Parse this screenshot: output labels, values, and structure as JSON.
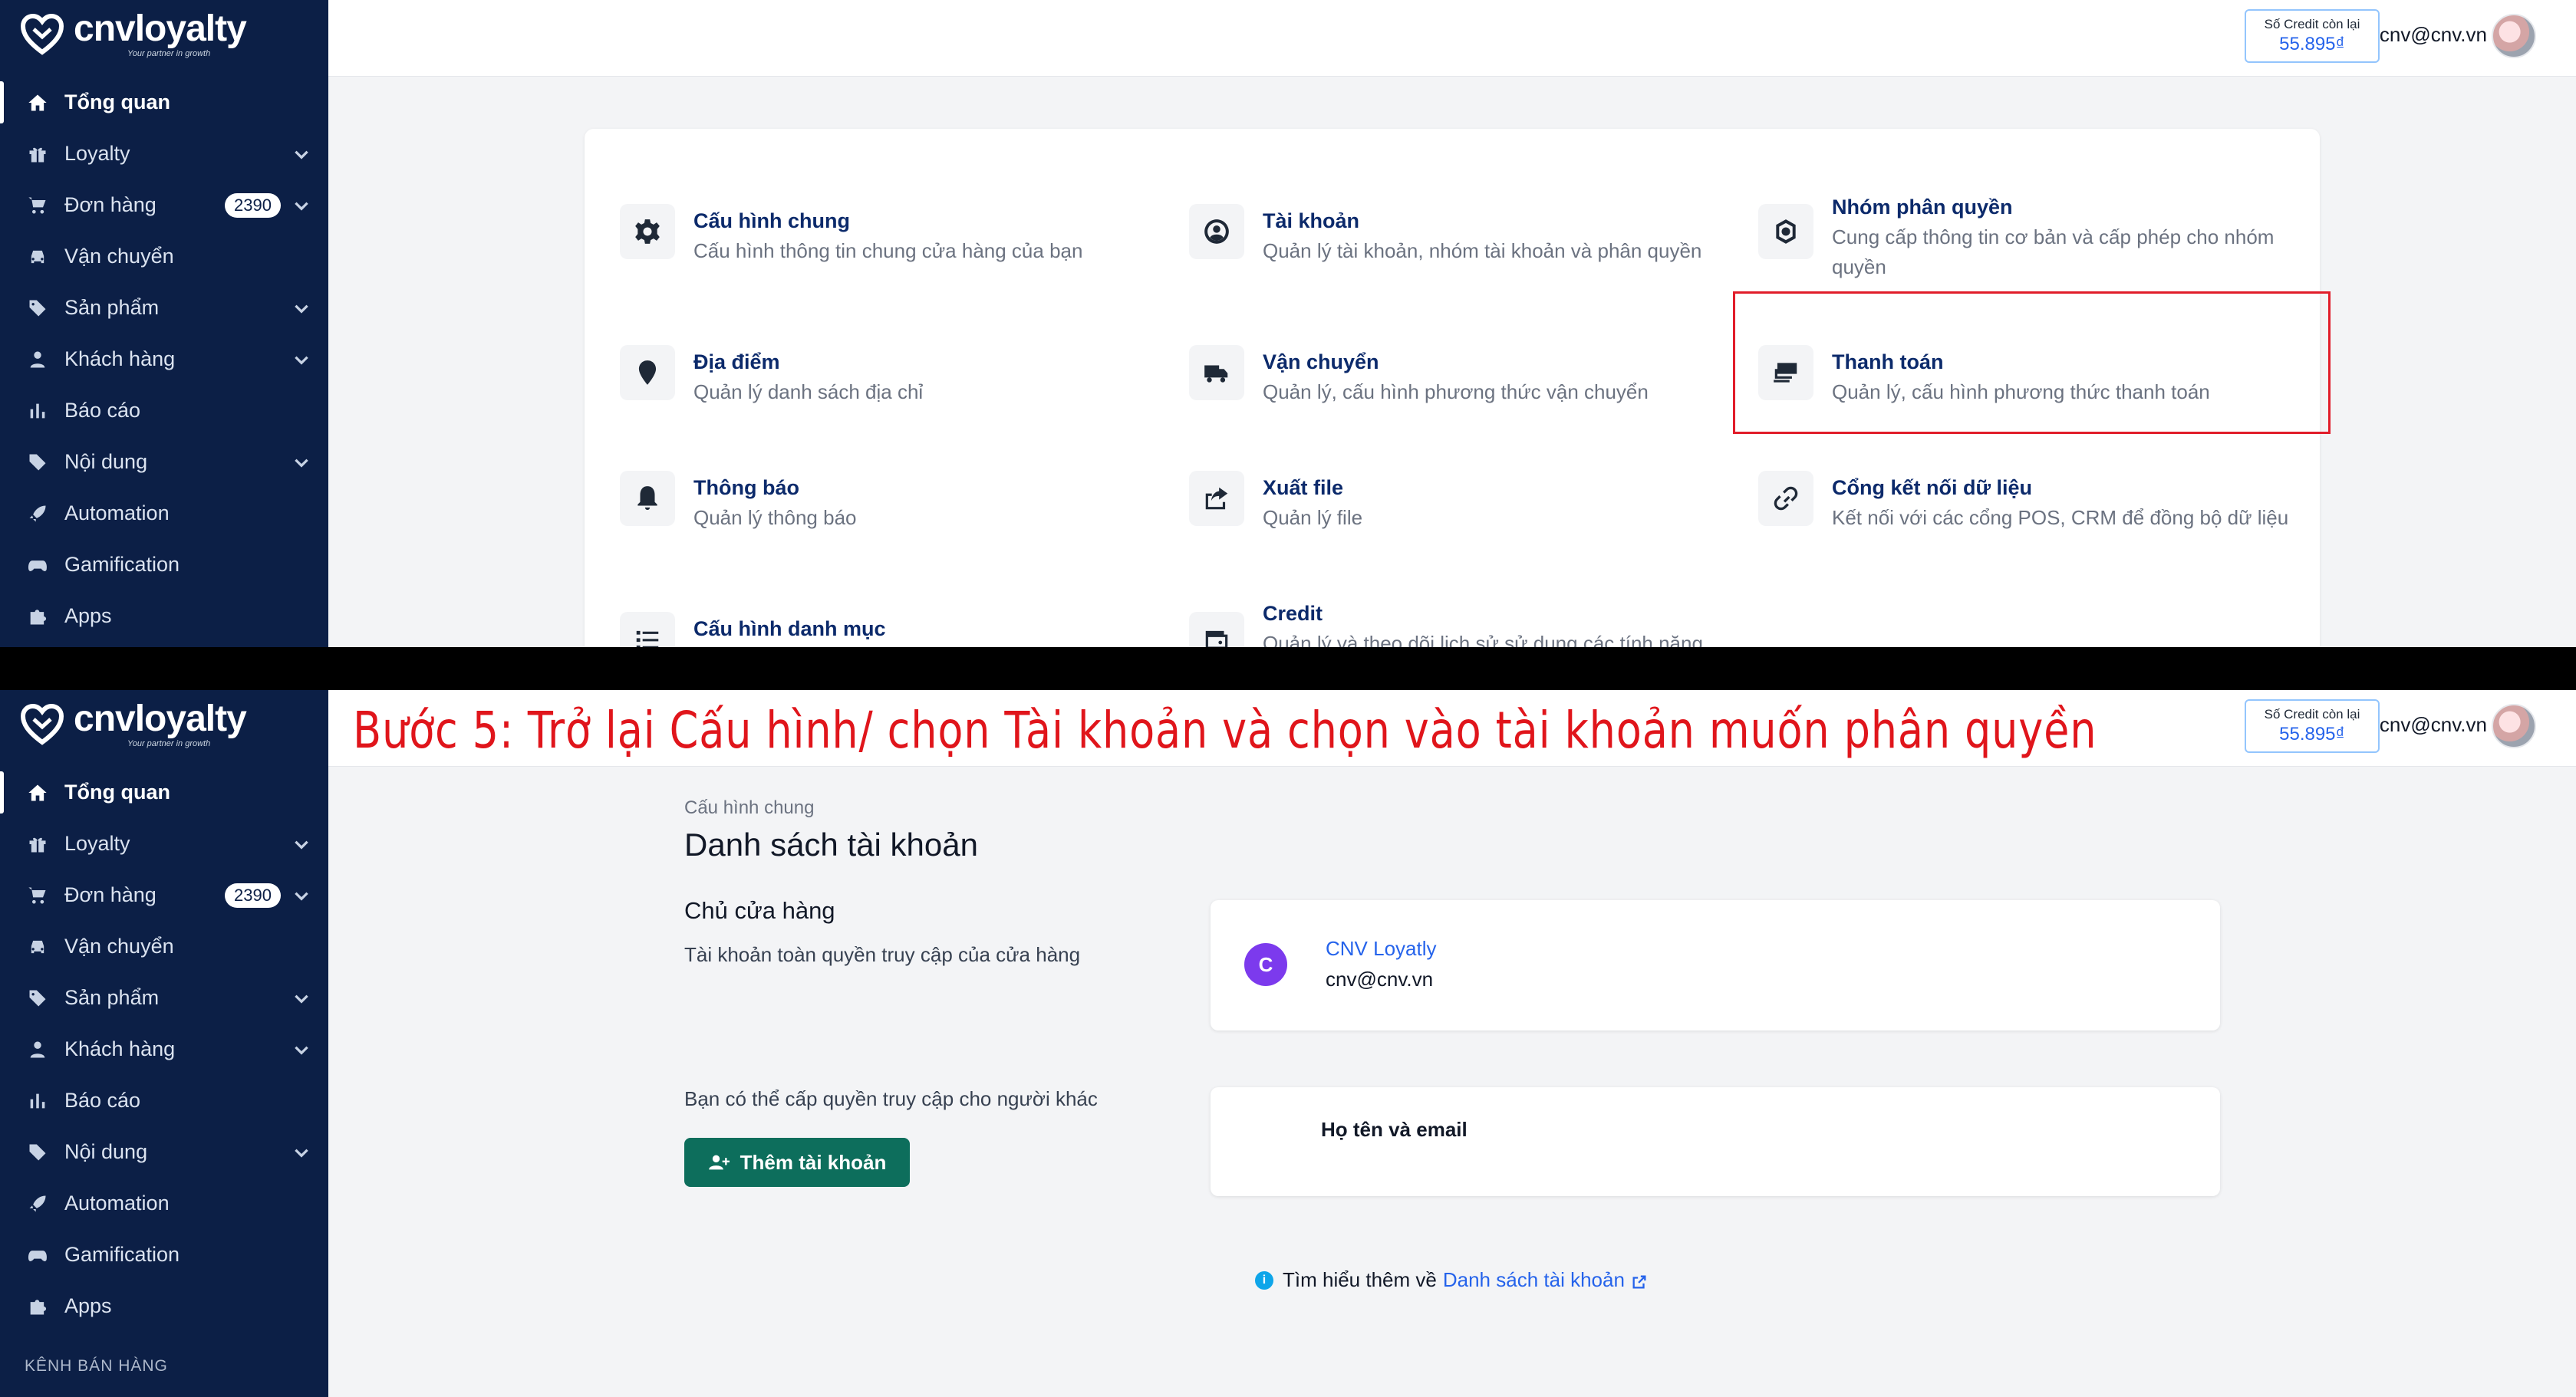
{
  "brand": {
    "name": "cnvloyalty",
    "tagline": "Your partner in growth"
  },
  "sidebar": {
    "items": [
      {
        "label": "Tổng quan",
        "icon": "home-icon",
        "active": true
      },
      {
        "label": "Loyalty",
        "icon": "gift-icon",
        "chevron": true
      },
      {
        "label": "Đơn hàng",
        "icon": "cart-icon",
        "badge": "2390",
        "chevron": true
      },
      {
        "label": "Vận chuyển",
        "icon": "car-icon"
      },
      {
        "label": "Sản phẩm",
        "icon": "tag-icon",
        "chevron": true
      },
      {
        "label": "Khách hàng",
        "icon": "person-icon",
        "chevron": true
      },
      {
        "label": "Báo cáo",
        "icon": "bar-chart-icon"
      },
      {
        "label": "Nội dung",
        "icon": "content-icon",
        "chevron": true
      },
      {
        "label": "Automation",
        "icon": "rocket-icon"
      },
      {
        "label": "Gamification",
        "icon": "gamepad-icon"
      },
      {
        "label": "Apps",
        "icon": "puzzle-icon"
      }
    ],
    "section_label": "KÊNH BÁN HÀNG"
  },
  "topbar": {
    "credit_label": "Số Credit còn lại",
    "credit_value": "55.895₫",
    "user_email": "cnv@cnv.vn"
  },
  "settings": {
    "items": [
      {
        "title": "Cấu hình chung",
        "desc": "Cấu hình thông tin chung cửa hàng của bạn",
        "icon": "gear-icon"
      },
      {
        "title": "Tài khoản",
        "desc": "Quản lý tài khoản, nhóm tài khoản và phân quyền",
        "icon": "account-icon"
      },
      {
        "title": "Nhóm phân quyền",
        "desc1": "Cung cấp thông tin cơ bản và cấp phép cho nhóm",
        "desc2": "quyền",
        "icon": "permission-icon"
      },
      {
        "title": "Địa điểm",
        "desc": "Quản lý danh sách địa chỉ",
        "icon": "location-pin-icon"
      },
      {
        "title": "Vận chuyển",
        "desc": "Quản lý, cấu hình phương thức vận chuyển",
        "icon": "truck-icon"
      },
      {
        "title": "Thanh toán",
        "desc": "Quản lý, cấu hình phương thức thanh toán",
        "icon": "payment-icon"
      },
      {
        "title": "Thông báo",
        "desc": "Quản lý thông báo",
        "icon": "bell-icon"
      },
      {
        "title": "Xuất file",
        "desc": "Quản lý file",
        "icon": "export-icon"
      },
      {
        "title": "Cổng kết nối dữ liệu",
        "desc": "Kết nối với các cổng POS, CRM để đồng bộ dữ liệu",
        "icon": "link-icon"
      },
      {
        "title": "Cấu hình danh mục",
        "desc": "",
        "icon": "list-icon"
      },
      {
        "title": "Credit",
        "desc": "Quản lý và theo dõi lịch sử sử dụng các tính năng",
        "icon": "wallet-icon"
      }
    ]
  },
  "instruction": "Bước 5: Trở lại Cấu hình/ chọn Tài khoản và chọn vào tài khoản muốn phân quyền",
  "accounts": {
    "breadcrumb": "Cấu hình chung",
    "title": "Danh sách tài khoản",
    "owner_section_title": "Chủ cửa hàng",
    "owner_section_desc": "Tài khoản toàn quyền truy cập của cửa hàng",
    "owner": {
      "initial": "C",
      "name": "CNV Loyatly",
      "email": "cnv@cnv.vn"
    },
    "invite_text": "Bạn có thể cấp quyền truy cập cho người khác",
    "add_button": "Thêm tài khoản",
    "column_name_email": "Họ tên và email",
    "learn_prefix": "Tìm hiểu thêm về",
    "learn_link": "Danh sách tài khoản"
  }
}
